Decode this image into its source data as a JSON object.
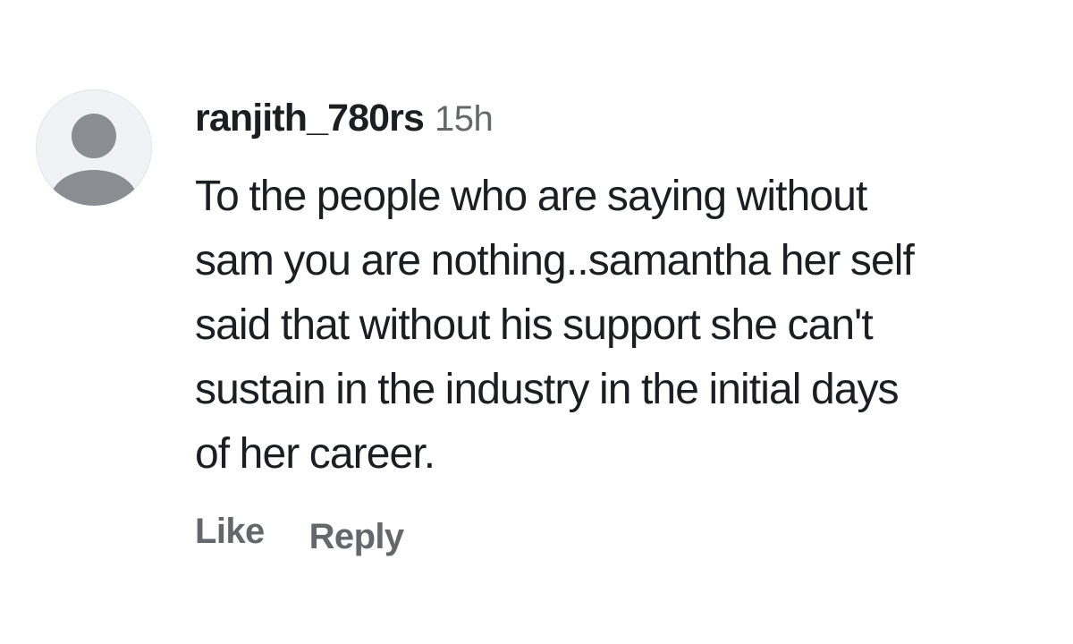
{
  "comment": {
    "avatar_icon": "default-user-avatar-icon",
    "username": "ranjith_780rs",
    "timestamp": "15h",
    "text": "To the people who are saying without\nsam you are nothing..samantha her self\nsaid that without his support she can't\nsustain in the industry in the initial days\nof her career.",
    "actions": {
      "like_label": "Like",
      "reply_label": "Reply"
    }
  },
  "colors": {
    "text_primary": "#1c1e21",
    "text_secondary": "#65676b",
    "avatar_background": "#f0f2f5",
    "avatar_silhouette": "#8a8d91"
  }
}
